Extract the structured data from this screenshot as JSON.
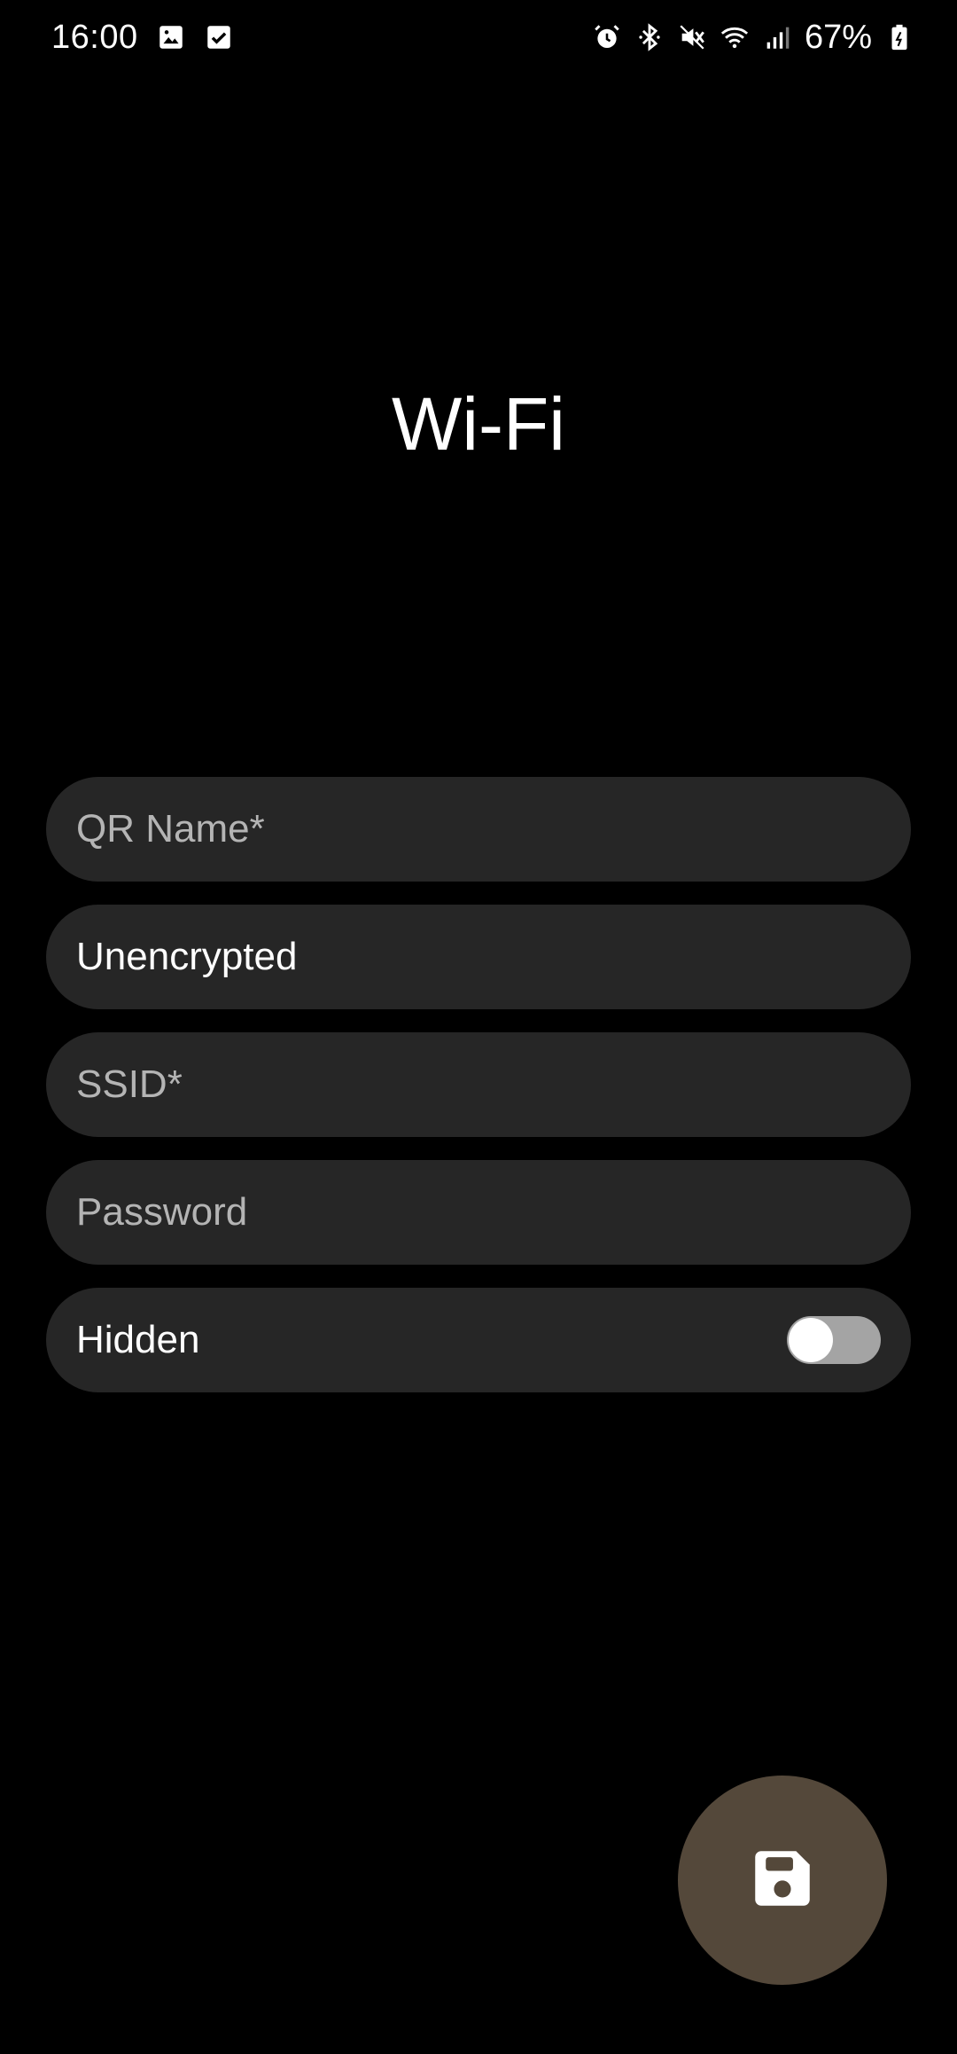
{
  "status_bar": {
    "time": "16:00",
    "battery": "67%",
    "icons_left": [
      "gallery-icon",
      "checkbox-icon"
    ],
    "icons_right": [
      "alarm-icon",
      "bluetooth-icon",
      "mute-icon",
      "wifi-icon",
      "signal-icon",
      "battery-icon"
    ]
  },
  "page": {
    "title": "Wi-Fi"
  },
  "form": {
    "qr_name": {
      "placeholder": "QR Name*",
      "value": ""
    },
    "encryption": {
      "value": "Unencrypted"
    },
    "ssid": {
      "placeholder": "SSID*",
      "value": ""
    },
    "password": {
      "placeholder": "Password",
      "value": ""
    },
    "hidden": {
      "label": "Hidden",
      "checked": false
    }
  },
  "fab": {
    "icon": "save-icon",
    "color": "#54483a"
  },
  "colors": {
    "background": "#000000",
    "field_background": "#262626",
    "placeholder_text": "#b4b4b4"
  }
}
